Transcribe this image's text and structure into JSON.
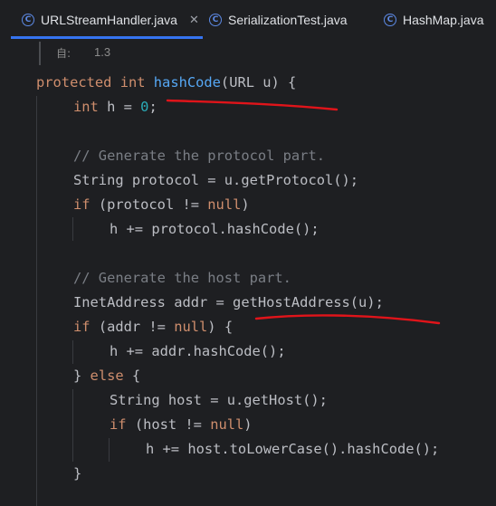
{
  "tabs": [
    {
      "label": "URLStreamHandler.java",
      "icon": "class-icon",
      "active": true,
      "closable": true
    },
    {
      "label": "SerializationTest.java",
      "icon": "class-icon",
      "active": false,
      "closable": false
    },
    {
      "label": "HashMap.java",
      "icon": "class-icon",
      "active": false,
      "closable": false
    }
  ],
  "doc": {
    "icon_glyph": "自:",
    "value": "1.3"
  },
  "code": {
    "l1": {
      "kw1": "protected",
      "kw2": "int",
      "name": "hashCode",
      "params": "(URL u) {"
    },
    "l2": {
      "kw": "int",
      "rest": " h = ",
      "num": "0",
      "end": ";"
    },
    "l4": {
      "comment": "// Generate the protocol part."
    },
    "l5": {
      "text": "String protocol = u.getProtocol();"
    },
    "l6": {
      "kw": "if",
      "pre": " (protocol != ",
      "kw2": "null",
      "post": ")"
    },
    "l7": {
      "text": "h += protocol.hashCode();"
    },
    "l9": {
      "comment": "// Generate the host part."
    },
    "l10": {
      "text": "InetAddress addr = getHostAddress(u);"
    },
    "l11": {
      "kw": "if",
      "pre": " (addr != ",
      "kw2": "null",
      "post": ") {"
    },
    "l12": {
      "text": "h += addr.hashCode();"
    },
    "l13": {
      "pre": "} ",
      "kw": "else",
      "post": " {"
    },
    "l14": {
      "text": "String host = u.getHost();"
    },
    "l15": {
      "kw": "if",
      "pre": " (host != ",
      "kw2": "null",
      "post": ")"
    },
    "l16": {
      "text": "h += host.toLowerCase().hashCode();"
    },
    "l17": {
      "text": "}"
    }
  },
  "colors": {
    "keyword": "#cf8e6d",
    "method": "#56a8f5",
    "number": "#2aacb8",
    "comment": "#7a7e85",
    "annotation": "#e0141a"
  }
}
